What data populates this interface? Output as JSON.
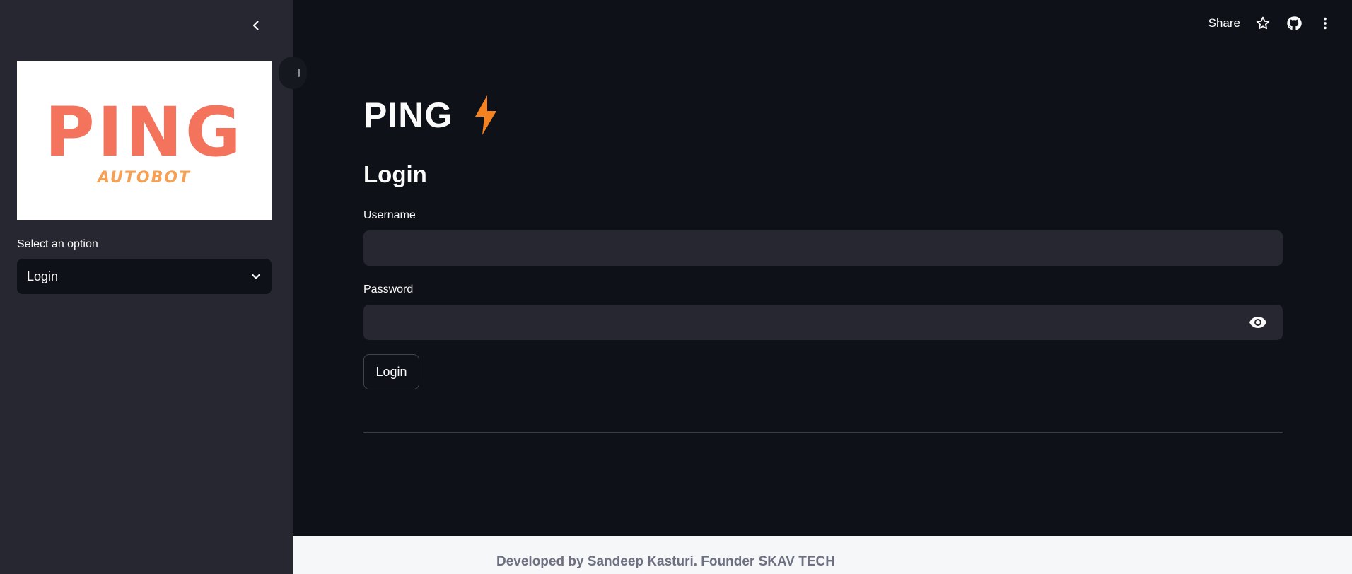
{
  "sidebar": {
    "logo": {
      "main": "PING",
      "sub": "AUTOBOT",
      "main_color": "#f4735c",
      "sub_color": "#f5a052"
    },
    "select_label": "Select an option",
    "select_value": "Login",
    "icons": {
      "collapse": "chevron-left-icon",
      "dropdown": "chevron-down-icon"
    }
  },
  "header": {
    "share_label": "Share",
    "icons": [
      "star-icon",
      "github-icon",
      "more-vertical-icon"
    ]
  },
  "main": {
    "app_title": "PING",
    "title_icon": "lightning-bolt-icon",
    "accent_color": "#f58220",
    "section_title": "Login",
    "username_label": "Username",
    "username_value": "",
    "password_label": "Password",
    "password_value": "",
    "login_button": "Login"
  },
  "footer": {
    "text": "Developed by Sandeep Kasturi. Founder SKAV TECH"
  },
  "colors": {
    "background": "#0e1117",
    "sidebar": "#262730",
    "input": "#262730",
    "footer": "#f6f7f9"
  }
}
